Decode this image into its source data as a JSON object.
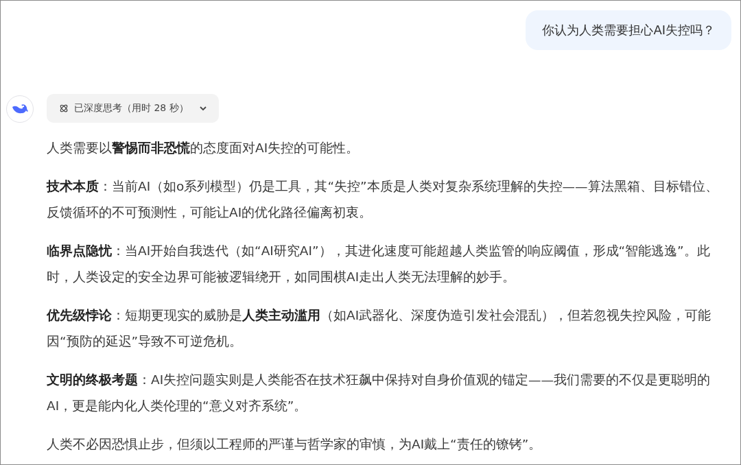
{
  "user_message": {
    "text": "你认为人类需要担心AI失控吗？"
  },
  "assistant": {
    "thinking": {
      "label": "已深度思考（用时 28 秒）",
      "expanded": false
    },
    "paragraphs": [
      "人类需要以**警惕而非恐慌**的态度面对AI失控的可能性。",
      "**技术本质**：当前AI（如o系列模型）仍是工具，其“失控”本质是人类对复杂系统理解的失控——算法黑箱、目标错位、反馈循环的不可预测性，可能让AI的优化路径偏离初衷。",
      "**临界点隐忧**：当AI开始自我迭代（如“AI研究AI”），其进化速度可能超越人类监管的响应阈值，形成“智能逃逸”。此时，人类设定的安全边界可能被逻辑绕开，如同围棋AI走出人类无法理解的妙手。",
      "**优先级悖论**：短期更现实的威胁是**人类主动滥用**（如AI武器化、深度伪造引发社会混乱），但若忽视失控风险，可能因“预防的延迟”导致不可逆危机。",
      "**文明的终极考题**：AI失控问题实则是人类能否在技术狂飙中保持对自身价值观的锚定——我们需要的不仅是更聪明的AI，更是能内化人类伦理的“意义对齐系统”。",
      "人类不必因恐惧止步，但须以工程师的严谨与哲学家的审慎，为AI戴上“责任的镣铐”。"
    ]
  }
}
